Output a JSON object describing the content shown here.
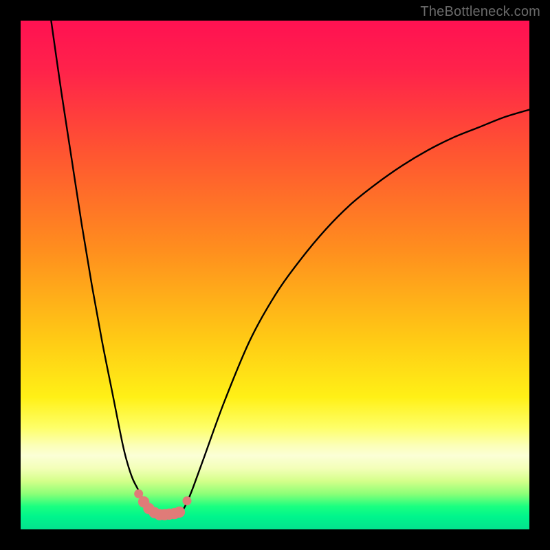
{
  "watermark": "TheBottleneck.com",
  "colors": {
    "frame": "#000000",
    "gradient_stops": [
      {
        "offset": 0.0,
        "color": "#ff1152"
      },
      {
        "offset": 0.1,
        "color": "#ff234a"
      },
      {
        "offset": 0.25,
        "color": "#ff5232"
      },
      {
        "offset": 0.45,
        "color": "#ff8e1e"
      },
      {
        "offset": 0.62,
        "color": "#ffc815"
      },
      {
        "offset": 0.74,
        "color": "#fff016"
      },
      {
        "offset": 0.8,
        "color": "#feff68"
      },
      {
        "offset": 0.835,
        "color": "#fbffb8"
      },
      {
        "offset": 0.855,
        "color": "#fbffd6"
      },
      {
        "offset": 0.88,
        "color": "#f3ffb8"
      },
      {
        "offset": 0.905,
        "color": "#d4ff8a"
      },
      {
        "offset": 0.93,
        "color": "#8dff77"
      },
      {
        "offset": 0.955,
        "color": "#1aff80"
      },
      {
        "offset": 0.975,
        "color": "#00f58c"
      },
      {
        "offset": 1.0,
        "color": "#03e38e"
      }
    ],
    "curve": "#000000",
    "marker_fill": "#e07b78",
    "marker_stroke": "#c9605d"
  },
  "chart_data": {
    "type": "line",
    "title": "",
    "xlabel": "",
    "ylabel": "",
    "xlim": [
      0,
      100
    ],
    "ylim": [
      0,
      100
    ],
    "series": [
      {
        "name": "left-branch",
        "x": [
          6,
          8,
          10,
          12,
          14,
          16,
          18,
          20,
          21,
          22,
          23,
          24,
          25,
          26,
          27
        ],
        "y": [
          100,
          86,
          73,
          60,
          48,
          37,
          27,
          17,
          13,
          10,
          8,
          6,
          4.5,
          3.5,
          3
        ]
      },
      {
        "name": "right-branch",
        "x": [
          31,
          32,
          33,
          34,
          36,
          40,
          45,
          50,
          55,
          60,
          65,
          70,
          75,
          80,
          85,
          90,
          95,
          100
        ],
        "y": [
          3.2,
          4,
          6,
          8.5,
          14,
          25,
          37,
          46,
          53,
          59,
          64,
          68,
          71.5,
          74.5,
          77,
          79,
          81,
          82.5
        ]
      }
    ],
    "markers": {
      "name": "highlight-points",
      "x": [
        23.2,
        24.2,
        25.2,
        26.3,
        27.3,
        28.3,
        29.2,
        30.2,
        31.2,
        32.7
      ],
      "y": [
        7.0,
        5.4,
        4.1,
        3.3,
        2.9,
        2.9,
        3.0,
        3.1,
        3.4,
        5.6
      ]
    },
    "background": "vertical-gradient-red-to-green"
  }
}
